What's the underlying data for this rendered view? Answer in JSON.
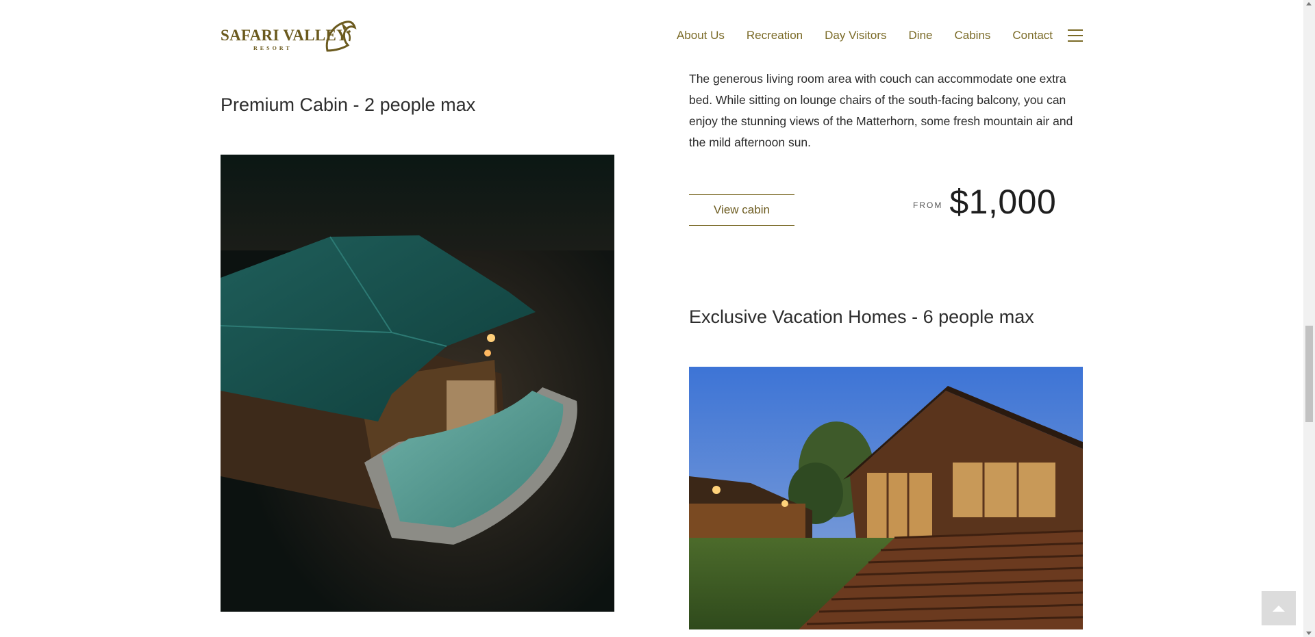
{
  "header": {
    "logo": {
      "brand": "SAFARI VALLEY",
      "tagline": "RESORT"
    },
    "nav": [
      {
        "label": "About Us"
      },
      {
        "label": "Recreation"
      },
      {
        "label": "Day Visitors"
      },
      {
        "label": "Dine"
      },
      {
        "label": "Cabins"
      },
      {
        "label": "Contact"
      }
    ],
    "menu_icon": "hamburger-icon"
  },
  "cabins": [
    {
      "title": "Premium Cabin - 2 people max",
      "image_alt": "Premium cabin with plunge pool at night"
    },
    {
      "title": "Exclusive Vacation Homes - 6 people max",
      "image_alt": "Exclusive vacation home with wooden deck at dusk"
    }
  ],
  "previous_cabin": {
    "description": "The generous living room area with couch can accommodate one extra bed. While sitting on lounge chairs of the south-facing balcony, you can enjoy the stunning views of the Matterhorn, some fresh mountain air and the mild afternoon sun.",
    "button_label": "View cabin",
    "price_prefix": "FROM",
    "price": "$1,000"
  },
  "back_to_top_icon": "chevron-up-icon",
  "colors": {
    "brand": "#7a6a26",
    "text": "#2a2a2a"
  }
}
